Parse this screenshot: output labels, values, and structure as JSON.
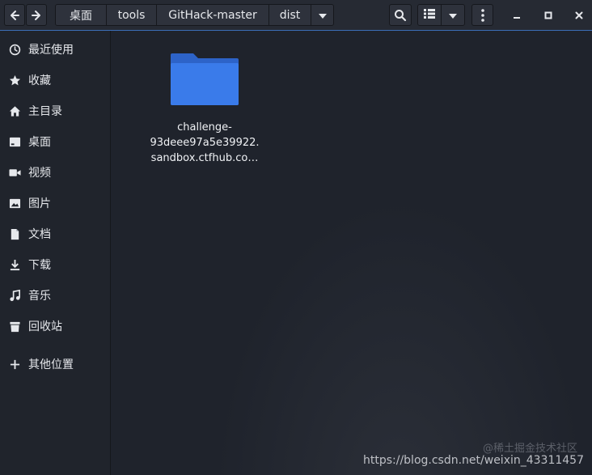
{
  "header": {
    "breadcrumbs": [
      "桌面",
      "tools",
      "GitHack-master",
      "dist"
    ],
    "icons": {
      "back": "arrow-left-icon",
      "forward": "arrow-right-icon",
      "dropdown": "caret-down-icon",
      "search": "search-icon",
      "view": "list-view-icon",
      "view_menu": "caret-down-icon",
      "menu": "kebab-menu-icon",
      "minimize": "minimize-icon",
      "maximize": "maximize-icon",
      "close": "close-icon"
    }
  },
  "sidebar": {
    "items": [
      {
        "label": "最近使用",
        "icon": "clock-icon"
      },
      {
        "label": "收藏",
        "icon": "star-icon"
      },
      {
        "label": "主目录",
        "icon": "home-icon"
      },
      {
        "label": "桌面",
        "icon": "desktop-icon"
      },
      {
        "label": "视频",
        "icon": "video-icon"
      },
      {
        "label": "图片",
        "icon": "image-icon"
      },
      {
        "label": "文档",
        "icon": "document-icon"
      },
      {
        "label": "下载",
        "icon": "download-icon"
      },
      {
        "label": "音乐",
        "icon": "music-icon"
      },
      {
        "label": "回收站",
        "icon": "trash-icon"
      },
      {
        "label": "其他位置",
        "icon": "plus-icon"
      }
    ]
  },
  "main": {
    "files": [
      {
        "name_lines": [
          "challenge-",
          "93deee97a5e39922.",
          "sandbox.ctfhub.co…"
        ],
        "icon": "folder-icon"
      }
    ]
  },
  "watermark": {
    "text": "https://blog.csdn.net/weixin_43311457",
    "overlay": "@稀土掘金技术社区"
  },
  "colors": {
    "accent": "#3c6fb8",
    "folder": "#3a7bea",
    "background": "#1f232c"
  }
}
